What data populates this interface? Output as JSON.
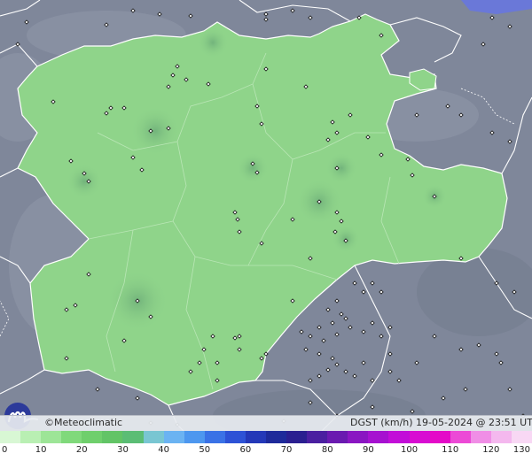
{
  "map": {
    "brand": "©Meteoclimatic",
    "parameter": "DGST (km/h)",
    "timestamp": "19-05-2024 @ 23:51 UTC",
    "land_color": "#7d8598",
    "region_fill": "#8fd48a",
    "region_fill_dark": "#79c575",
    "border_color": "#ffffff",
    "station_color": "#111111",
    "water_color": "#6a78d8"
  },
  "scale": {
    "tick_labels": [
      "0",
      "10",
      "20",
      "30",
      "40",
      "50",
      "60",
      "70",
      "80",
      "90",
      "100",
      "110",
      "120",
      "130"
    ],
    "colors": [
      "#d8f7d4",
      "#b9efb3",
      "#9de597",
      "#80d97b",
      "#6fcf6c",
      "#62c466",
      "#5bbd75",
      "#79c6d2",
      "#6bb3f2",
      "#4d97ef",
      "#3a72e6",
      "#2d52d6",
      "#2438b8",
      "#1e2a9a",
      "#2a1f90",
      "#4a1fa0",
      "#6a1ab0",
      "#8a16c2",
      "#a612d0",
      "#c20ed8",
      "#d80cd2",
      "#e40ac8",
      "#ec4ad6",
      "#f08ee6",
      "#f4b8ee",
      "#f8d8f4"
    ]
  }
}
